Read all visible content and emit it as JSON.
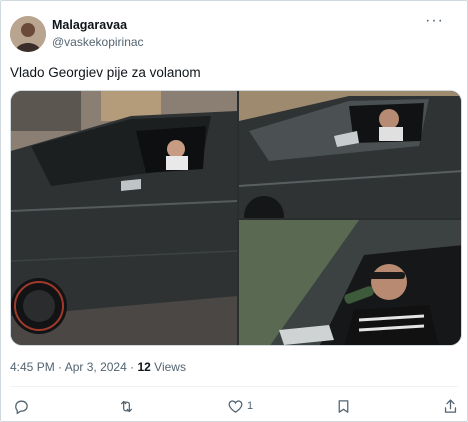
{
  "author": {
    "display_name": "Malagaravaa",
    "handle": "@vaskekopirinac"
  },
  "tweet": {
    "text": "Vlado Georgiev pije za volanom"
  },
  "meta": {
    "time": "4:45 PM",
    "separator": "·",
    "date": "Apr 3, 2024",
    "views_count": "12",
    "views_label": "Views"
  },
  "actions": {
    "reply_count": "",
    "retweet_count": "",
    "like_count": "1",
    "bookmark_count": ""
  },
  "icons": [
    "more-icon",
    "reply-icon",
    "retweet-icon",
    "like-icon",
    "bookmark-icon",
    "share-icon"
  ]
}
